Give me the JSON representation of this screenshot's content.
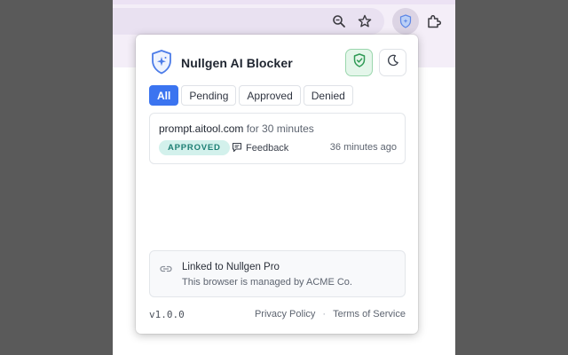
{
  "toolbar": {
    "zoom_icon": "zoom-icon",
    "bookmark_icon": "star-icon",
    "extension_icon": "shield-icon",
    "extensions_menu_icon": "puzzle-icon"
  },
  "popup": {
    "brand": "Nullgen AI Blocker",
    "filters": [
      {
        "label": "All",
        "active": true
      },
      {
        "label": "Pending",
        "active": false
      },
      {
        "label": "Approved",
        "active": false
      },
      {
        "label": "Denied",
        "active": false
      }
    ],
    "requests": [
      {
        "domain": "prompt.aitool.com",
        "duration": "for 30 minutes",
        "status": "APPROVED",
        "feedback_label": "Feedback",
        "time_ago": "36 minutes ago"
      }
    ],
    "linked": {
      "title": "Linked to Nullgen Pro",
      "subtitle": "This browser is managed by ACME Co."
    },
    "footer": {
      "version": "v1.0.0",
      "privacy": "Privacy Policy",
      "separator": "·",
      "terms": "Terms of Service"
    }
  },
  "colors": {
    "accent": "#3b74f0",
    "approved_bg": "#d3f1ec",
    "approved_text": "#1d7f74",
    "shield_green": "#2f9a55"
  }
}
